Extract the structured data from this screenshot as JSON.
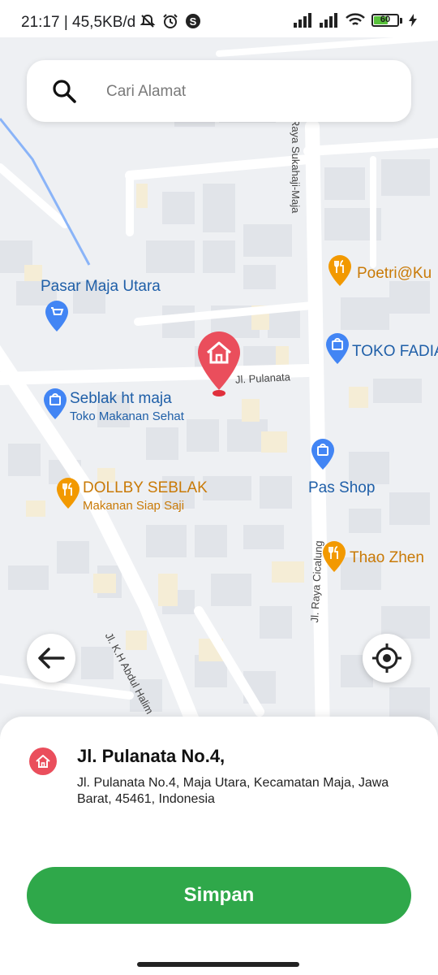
{
  "status_bar": {
    "time": "21:17",
    "network_speed": "| 45,5KB/d",
    "battery_level": "60",
    "battery_fraction": 0.6
  },
  "search": {
    "placeholder": "Cari Alamat",
    "value": ""
  },
  "map": {
    "poi": [
      {
        "name": "Pasar Maja Utara",
        "type": "shop"
      },
      {
        "name": "Poetri@Ku",
        "type": "food"
      },
      {
        "name": "TOKO FADIA",
        "type": "shop"
      },
      {
        "name": "Seblak ht maja",
        "subtitle": "Toko Makanan Sehat",
        "type": "shop"
      },
      {
        "name": "Pas Shop",
        "type": "shop"
      },
      {
        "name": "DOLLBY SEBLAK",
        "subtitle": "Makanan Siap Saji",
        "type": "food"
      },
      {
        "name": "Thao Zhen",
        "type": "food"
      }
    ],
    "roads": [
      "Jl. Pulanata",
      "Jl. K.H Abdul Halim",
      "Raya Sukahaji-Maja",
      "Jl. Raya Cicalung"
    ],
    "marker_icon": "home-icon"
  },
  "sheet": {
    "title": "Jl. Pulanata No.4,",
    "detail": "Jl. Pulanata No.4, Maja Utara, Kecamatan Maja, Jawa Barat, 45461, Indonesia",
    "save_label": "Simpan"
  },
  "colors": {
    "accent_green": "#2fa84a",
    "marker_red": "#ea4e5c",
    "poi_blue": "#1f5fa8",
    "poi_orange": "#c97a07"
  }
}
